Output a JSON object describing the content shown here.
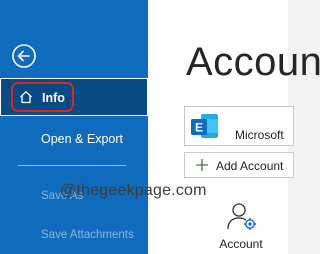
{
  "sidebar": {
    "back_icon": "back-arrow-circle-icon",
    "items": [
      {
        "label": "Info",
        "icon": "home-icon",
        "selected": true
      },
      {
        "label": "Open & Export"
      },
      {
        "label": "Save As"
      },
      {
        "label": "Save Attachments"
      }
    ]
  },
  "main": {
    "title": "Account",
    "account_card": {
      "icon": "exchange-icon",
      "name": "Microsoft"
    },
    "add_account_label": "Add Account",
    "account_settings_label": "Account",
    "account_settings_icon": "account-settings-icon"
  },
  "overlay": {
    "watermark": "@thegeekpage.com",
    "highlight_color": "#d62828"
  },
  "colors": {
    "sidebar": "#0f6cbd",
    "selected_item": "#0a4a82",
    "exchange_blue": "#0a6cc4"
  }
}
